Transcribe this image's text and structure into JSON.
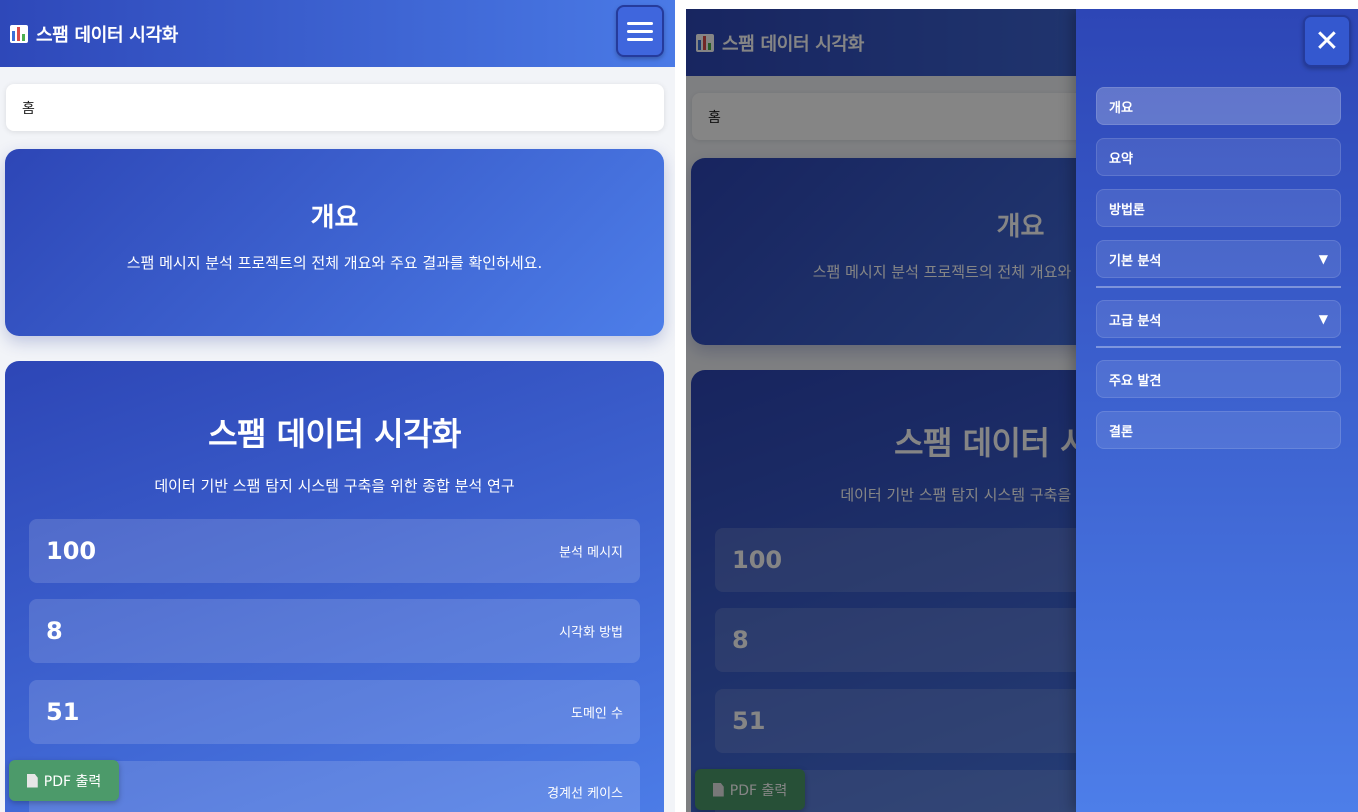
{
  "app": {
    "title": "스팸 데이터 시각화",
    "logo_icon": "bar-chart-icon"
  },
  "breadcrumb": {
    "current": "홈"
  },
  "hero": {
    "title": "개요",
    "description": "스팸 메시지 분석 프로젝트의 전체 개요와 주요 결과를 확인하세요."
  },
  "main": {
    "title": "스팸 데이터 시각화",
    "subtitle": "데이터 기반 스팸 탐지 시스템 구축을 위한 종합 분석 연구",
    "stats": [
      {
        "value": "100",
        "label": "분석 메시지"
      },
      {
        "value": "8",
        "label": "시각화 방법"
      },
      {
        "value": "51",
        "label": "도메인 수"
      },
      {
        "value": "",
        "label": "경계선 케이스"
      }
    ]
  },
  "pdf_button": {
    "label": "PDF 출력",
    "icon": "document-icon"
  },
  "nav": {
    "close_icon": "close-icon",
    "menu_icon": "hamburger-menu-icon",
    "items": [
      {
        "label": "개요",
        "active": true
      },
      {
        "label": "요약"
      },
      {
        "label": "방법론"
      },
      {
        "label": "기본 분석",
        "caret": "▼"
      },
      {
        "label": "고급 분석",
        "caret": "▼"
      },
      {
        "label": "주요 발견"
      },
      {
        "label": "결론"
      }
    ]
  },
  "colors": {
    "primary_start": "#2d46b6",
    "primary_end": "#4d7ee9",
    "pdf_button": "#4c9a6a"
  }
}
